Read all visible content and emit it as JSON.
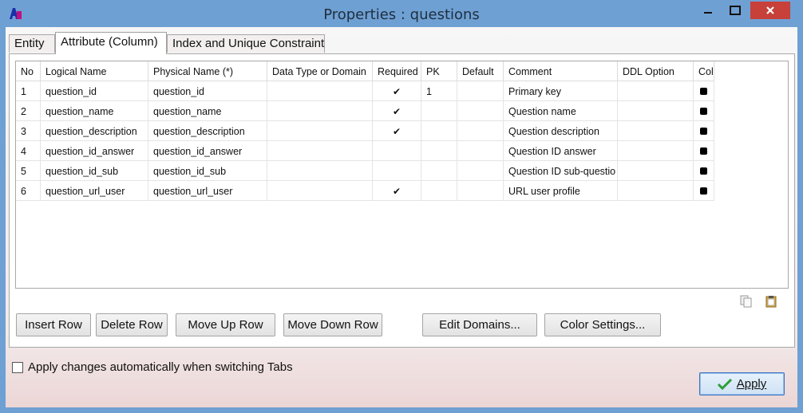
{
  "window": {
    "title": "Properties : questions"
  },
  "tabs": [
    {
      "label": "Entity"
    },
    {
      "label": "Attribute (Column)",
      "active": true
    },
    {
      "label": "Index and Unique Constraint"
    }
  ],
  "grid": {
    "columns": [
      "No",
      "Logical Name",
      "Physical Name (*)",
      "Data Type or Domain",
      "Required",
      "PK",
      "Default",
      "Comment",
      "DDL Option",
      "Colo"
    ],
    "rows": [
      {
        "no": "1",
        "logical": "question_id",
        "physical": "question_id",
        "type": "",
        "required": "✔",
        "pk": "1",
        "default": "",
        "comment": "Primary key",
        "ddl": "",
        "color": "#000000"
      },
      {
        "no": "2",
        "logical": "question_name",
        "physical": "question_name",
        "type": "",
        "required": "✔",
        "pk": "",
        "default": "",
        "comment": "Question name",
        "ddl": "",
        "color": "#000000"
      },
      {
        "no": "3",
        "logical": "question_description",
        "physical": "question_description",
        "type": "",
        "required": "✔",
        "pk": "",
        "default": "",
        "comment": "Question description",
        "ddl": "",
        "color": "#000000"
      },
      {
        "no": "4",
        "logical": "question_id_answer",
        "physical": "question_id_answer",
        "type": "",
        "required": "",
        "pk": "",
        "default": "",
        "comment": "Question ID answer",
        "ddl": "",
        "color": "#000000"
      },
      {
        "no": "5",
        "logical": "question_id_sub",
        "physical": "question_id_sub",
        "type": "",
        "required": "",
        "pk": "",
        "default": "",
        "comment": "Question ID sub-questio",
        "ddl": "",
        "color": "#000000"
      },
      {
        "no": "6",
        "logical": "question_url_user",
        "physical": "question_url_user",
        "type": "",
        "required": "✔",
        "pk": "",
        "default": "",
        "comment": "URL user profile",
        "ddl": "",
        "color": "#000000"
      }
    ]
  },
  "buttons": {
    "insert_row": "Insert Row",
    "delete_row": "Delete Row",
    "move_up_row": "Move Up Row",
    "move_down_row": "Move Down Row",
    "edit_domains": "Edit Domains...",
    "color_settings": "Color Settings..."
  },
  "auto_apply": {
    "label": "Apply changes automatically when switching Tabs",
    "checked": false
  },
  "apply": {
    "label": "Apply"
  },
  "icons": {
    "app": "app-logo-icon",
    "copy": "copy-icon",
    "paste": "paste-icon",
    "apply": "checkmark-icon"
  },
  "colors": {
    "titlebar": "#6fa0d3",
    "close": "#c7403a",
    "apply_check": "#2e9e3a"
  }
}
